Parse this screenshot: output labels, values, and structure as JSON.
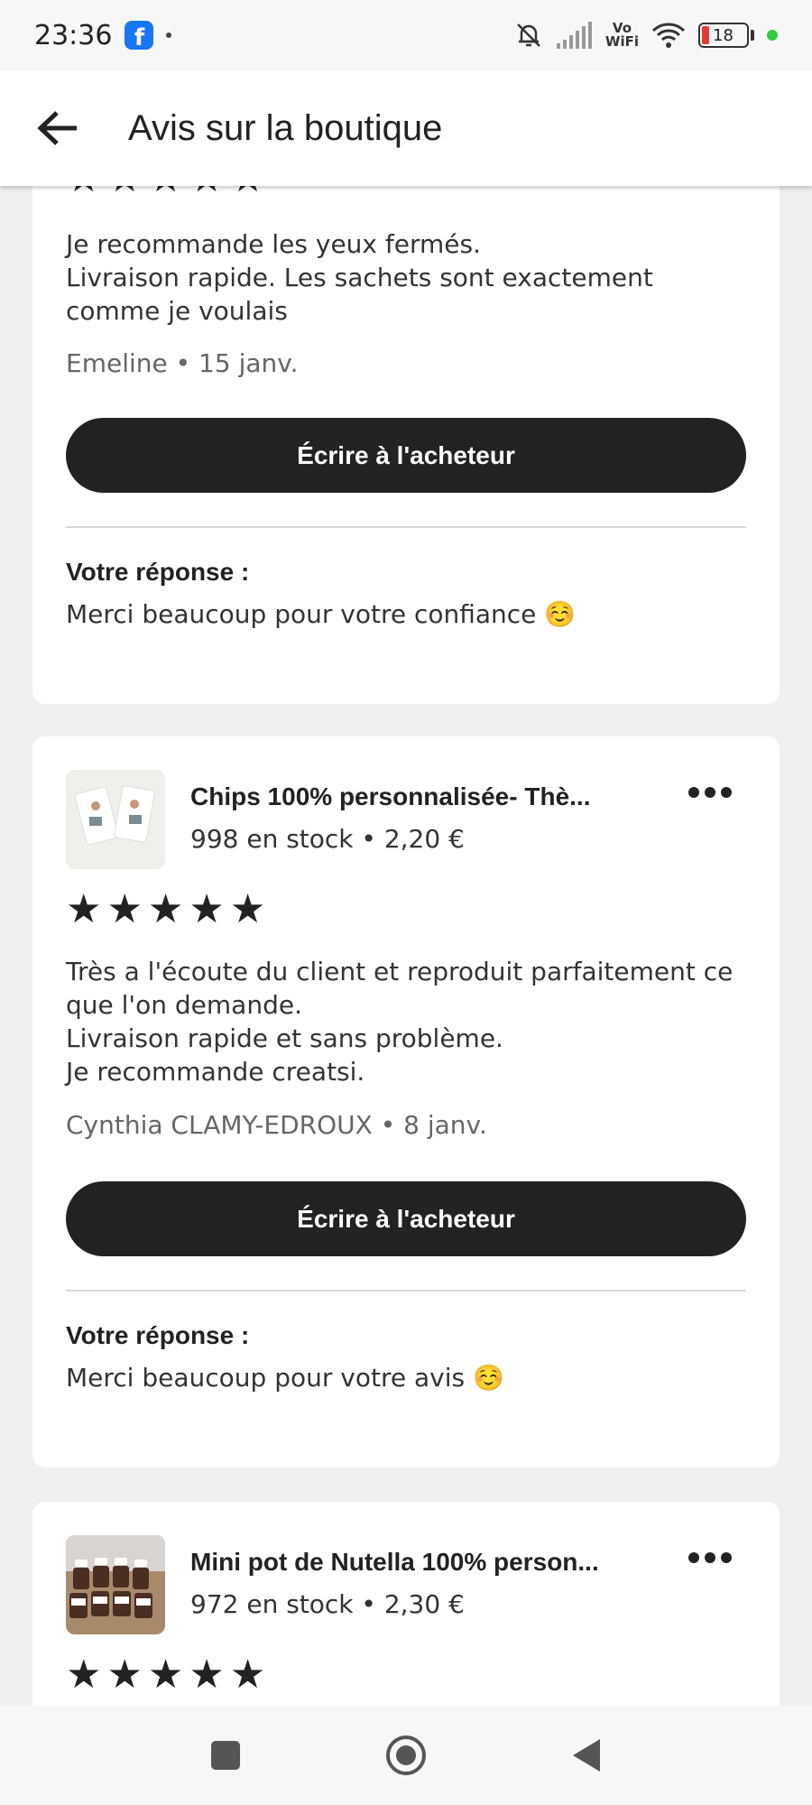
{
  "status_bar": {
    "time": "23:36",
    "app_icon": "facebook-icon",
    "network_label_top": "Vo",
    "network_label_bottom": "WiFi",
    "battery": "18"
  },
  "app_bar": {
    "title": "Avis sur la boutique",
    "back_icon": "arrow-left-icon"
  },
  "reviews": [
    {
      "stars": 5,
      "text": "Je recommande les yeux fermés.\nLivraison rapide. Les sachets sont exactement comme je voulais",
      "reviewer": "Emeline • 15 janv.",
      "button_label": "Écrire à l'acheteur",
      "response_label": "Votre réponse :",
      "response_text": "Merci beaucoup pour votre confiance ☺️"
    },
    {
      "listing_title": "Chips 100% personnalisée- Thè...",
      "listing_meta": "998 en stock • 2,20 €",
      "stars": 5,
      "text": "Très a l'écoute du client et reproduit parfaitement ce que l'on demande.\nLivraison rapide et sans problème.\nJe recommande creatsi.",
      "reviewer": "Cynthia CLAMY-EDROUX • 8 janv.",
      "button_label": "Écrire à l'acheteur",
      "response_label": "Votre réponse :",
      "response_text": "Merci beaucoup pour votre avis ☺️"
    },
    {
      "listing_title": "Mini pot de Nutella 100% person...",
      "listing_meta": "972 en stock • 2,30 €",
      "stars": 5
    }
  ],
  "star_glyph": "★",
  "nav": [
    "recent-apps-icon",
    "home-icon",
    "back-triangle-icon"
  ]
}
